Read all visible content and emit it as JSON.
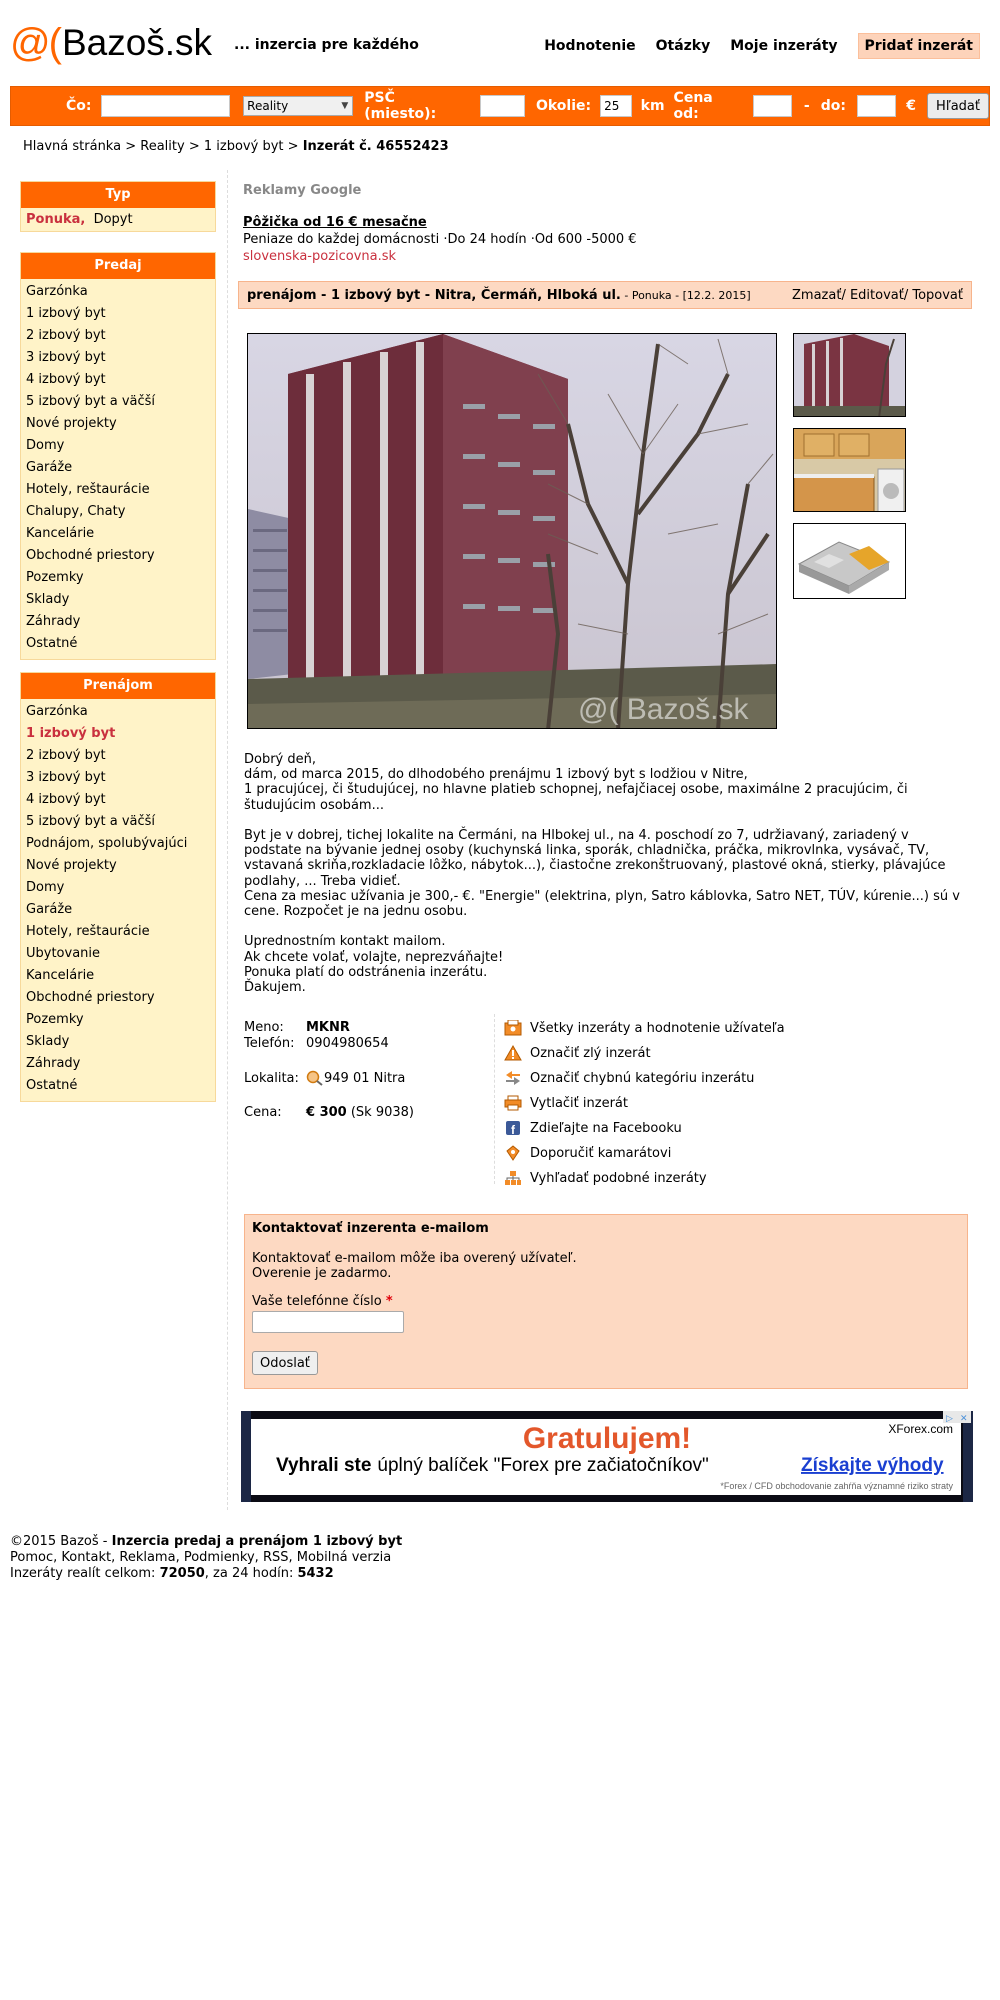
{
  "header": {
    "logo_symbol": "@(",
    "logo_text": "Bazoš.sk",
    "tagline": "... inzercia pre každého",
    "nav": [
      "Hodnotenie",
      "Otázky",
      "Moje inzeráty"
    ],
    "add_button": "Pridať inzerát"
  },
  "search": {
    "co_label": "Čo:",
    "co_value": "",
    "category": "Reality",
    "psc_label": "PSČ  (miesto):",
    "psc_value": "",
    "okolie_label": "Okolie:",
    "okolie_value": "25",
    "km_label": "km",
    "cena_label": "Cena  od:",
    "cena_od": "",
    "dash": "-",
    "do_label": "do:",
    "cena_do": "",
    "currency": "€",
    "button": "Hľadať"
  },
  "breadcrumb": {
    "items": [
      "Hlavná stránka",
      "Reality",
      "1 izbový byt"
    ],
    "separator": ">",
    "current": "Inzerát č. 46552423"
  },
  "sidebar": {
    "typ": {
      "title": "Typ",
      "ponuka": "Ponuka,",
      "dopyt": "Dopyt"
    },
    "predaj": {
      "title": "Predaj",
      "items": [
        "Garzónka",
        "1 izbový byt",
        "2 izbový byt",
        "3 izbový byt",
        "4 izbový byt",
        "5 izbový byt a väčší",
        "Nové projekty",
        "Domy",
        "Garáže",
        "Hotely, reštaurácie",
        "Chalupy, Chaty",
        "Kancelárie",
        "Obchodné priestory",
        "Pozemky",
        "Sklady",
        "Záhrady",
        "Ostatné"
      ]
    },
    "prenajom": {
      "title": "Prenájom",
      "items": [
        "Garzónka",
        "1 izbový byt",
        "2 izbový byt",
        "3 izbový byt",
        "4 izbový byt",
        "5 izbový byt a väčší",
        "Podnájom, spolubývajúci",
        "Nové projekty",
        "Domy",
        "Garáže",
        "Hotely, reštaurácie",
        "Ubytovanie",
        "Kancelárie",
        "Obchodné priestory",
        "Pozemky",
        "Sklady",
        "Záhrady",
        "Ostatné"
      ],
      "active_index": 1
    }
  },
  "ads": {
    "google_label": "Reklamy Google",
    "ad1_title": "Pôžička od 16 € mesačne",
    "ad1_text": "Peniaze do každej domácnosti ·Do 24 hodín ·Od 600 -5000 €",
    "ad1_url": "slovenska-pozicovna.sk",
    "banner_title": "Gratulujem!",
    "banner_brand": "XForex.com",
    "banner_text_bold": "Vyhrali ste",
    "banner_text": "úplný balíček \"Forex pre začiatočníkov\"",
    "banner_cta": "Získajte výhody",
    "banner_disclaimer": "*Forex / CFD obchodovanie zahŕňa významné riziko straty"
  },
  "listing": {
    "title": "prenájom - 1 izbový byt - Nitra, Čermáň, Hlboká ul.",
    "meta": " - Ponuka - [12.2. 2015]",
    "actions": "Zmazať/ Editovať/ Topovať",
    "watermark": "@( Bazoš.sk",
    "description": "Dobrý deň,\ndám, od marca 2015, do dlhodobého prenájmu 1 izbový byt s lodžiou v Nitre,\n1 pracujúcej, či študujúcej, no hlavne platieb schopnej, nefajčiacej osobe, maximálne 2 pracujúcim, či študujúcim osobám...\n\nByt je v dobrej, tichej lokalite na Čermáni, na Hlbokej ul., na 4. poschodí zo 7, udržiavaný, zariadený v podstate na bývanie jednej osoby (kuchynská linka, sporák, chladnička, práčka, mikrovlnka, vysávač, TV, vstavaná skriňa,rozkladacie lôžko, nábytok...), čiastočne zrekonštruovaný, plastové okná, stierky, plávajúce podlahy, ... Treba vidieť.\nCena za mesiac užívania je 300,- €. \"Energie\" (elektrina, plyn, Satro káblovka, Satro NET, TÚV, kúrenie...) sú v cene. Rozpočet je na jednu osobu.\n\nUprednostním kontakt mailom.\nAk chcete volať, volajte, neprezváňajte!\nPonuka platí do odstránenia inzerátu.\nĎakujem."
  },
  "contact": {
    "meno_label": "Meno:",
    "meno": "MKNR",
    "telefon_label": "Telefón:",
    "telefon": "0904980654",
    "lokalita_label": "Lokalita:",
    "lokalita": "949 01 Nitra",
    "cena_label": "Cena:",
    "cena": "€ 300",
    "cena_sk": "(Sk 9038)"
  },
  "side_links": [
    {
      "label": "Všetky inzeráty a hodnotenie užívateľa",
      "icon": "user-listings-icon"
    },
    {
      "label": "Označiť zlý inzerát",
      "icon": "warning-icon"
    },
    {
      "label": "Označiť chybnú kategóriu inzerátu",
      "icon": "arrows-icon"
    },
    {
      "label": "Vytlačiť inzerát",
      "icon": "printer-icon"
    },
    {
      "label": "Zdieľajte na Facebooku",
      "icon": "facebook-icon"
    },
    {
      "label": "Doporučiť kamarátovi",
      "icon": "recommend-icon"
    },
    {
      "label": "Vyhľadať podobné inzeráty",
      "icon": "similar-icon"
    }
  ],
  "email_form": {
    "title": "Kontaktovať inzerenta e-mailom",
    "note1": "Kontaktovať e-mailom môže iba overený užívateľ.",
    "note2": "Overenie je zadarmo.",
    "phone_label": "Vaše telefónne číslo",
    "required_mark": "*",
    "phone_value": "",
    "submit": "Odoslať"
  },
  "footer": {
    "copyright": "©2015 Bazoš - ",
    "headline": "Inzercia predaj a prenájom 1 izbový byt",
    "links": "Pomoc, Kontakt, Reklama, Podmienky, RSS, Mobilná verzia",
    "stats_label": "Inzeráty realít celkom: ",
    "stats_total": "72050",
    "stats_mid": ", za 24 hodín: ",
    "stats_24h": "5432"
  },
  "colors": {
    "brand_orange": "#ff6600",
    "sidebar_bg": "#fff3c8",
    "box_bg": "#fdd9c2",
    "active_red": "#c9303e"
  }
}
